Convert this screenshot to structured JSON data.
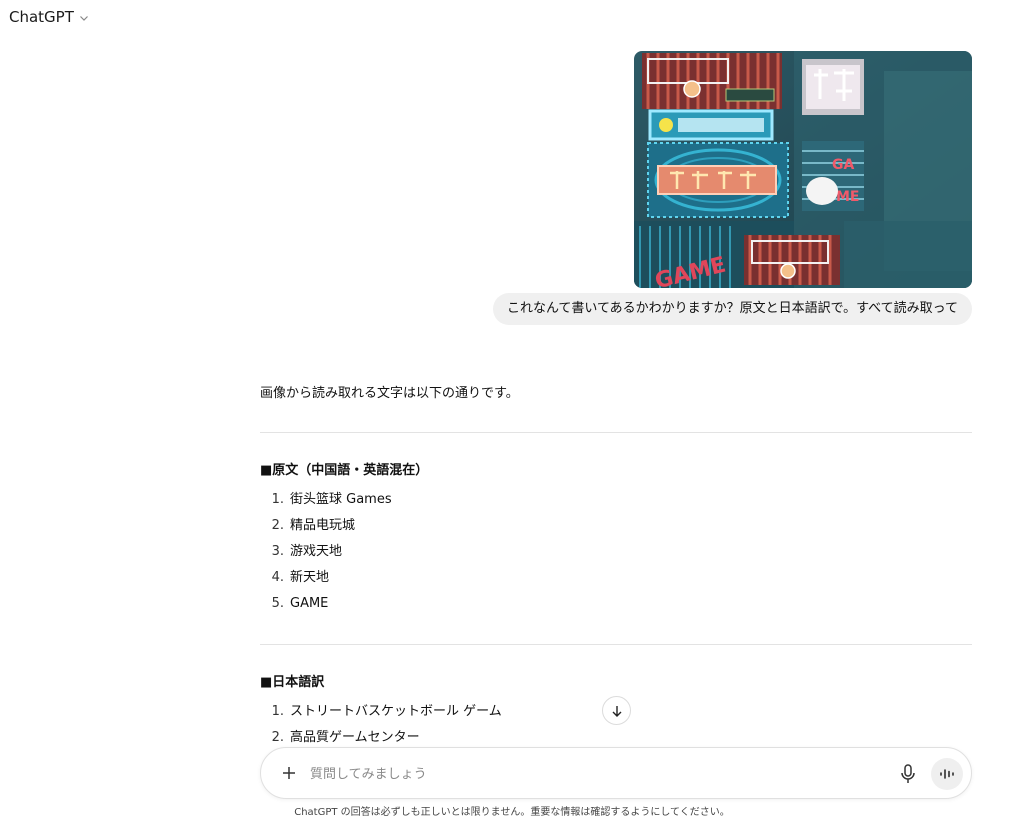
{
  "header": {
    "model_name": "ChatGPT"
  },
  "user_message": {
    "image_alt": "neon arcade signs photo",
    "text": "これなんて書いてあるかわかりますか？原文と日本語訳で。すべて読み取って"
  },
  "assistant_message": {
    "intro": "画像から読み取れる文字は以下の通りです。",
    "sections": [
      {
        "title": "■原文（中国語・英語混在）",
        "items": [
          {
            "num": "1.",
            "text": "街头篮球 Games"
          },
          {
            "num": "2.",
            "text": "精品电玩城"
          },
          {
            "num": "3.",
            "text": "游戏天地"
          },
          {
            "num": "4.",
            "text": "新天地"
          },
          {
            "num": "5.",
            "text": "GAME"
          }
        ]
      },
      {
        "title": "■日本語訳",
        "items": [
          {
            "num": "1.",
            "text": "ストリートバスケットボール ゲーム"
          },
          {
            "num": "2.",
            "text": "高品質ゲームセンター"
          }
        ]
      }
    ]
  },
  "composer": {
    "placeholder": "質問してみましょう",
    "value": ""
  },
  "footer": {
    "disclaimer": "ChatGPT の回答は必ずしも正しいとは限りません。重要な情報は確認するようにしてください。"
  },
  "icons": {
    "model_chevron": "chevron-down-icon",
    "scroll": "arrow-down-icon",
    "attach": "plus-icon",
    "mic": "microphone-icon",
    "voice": "voice-mode-icon"
  }
}
